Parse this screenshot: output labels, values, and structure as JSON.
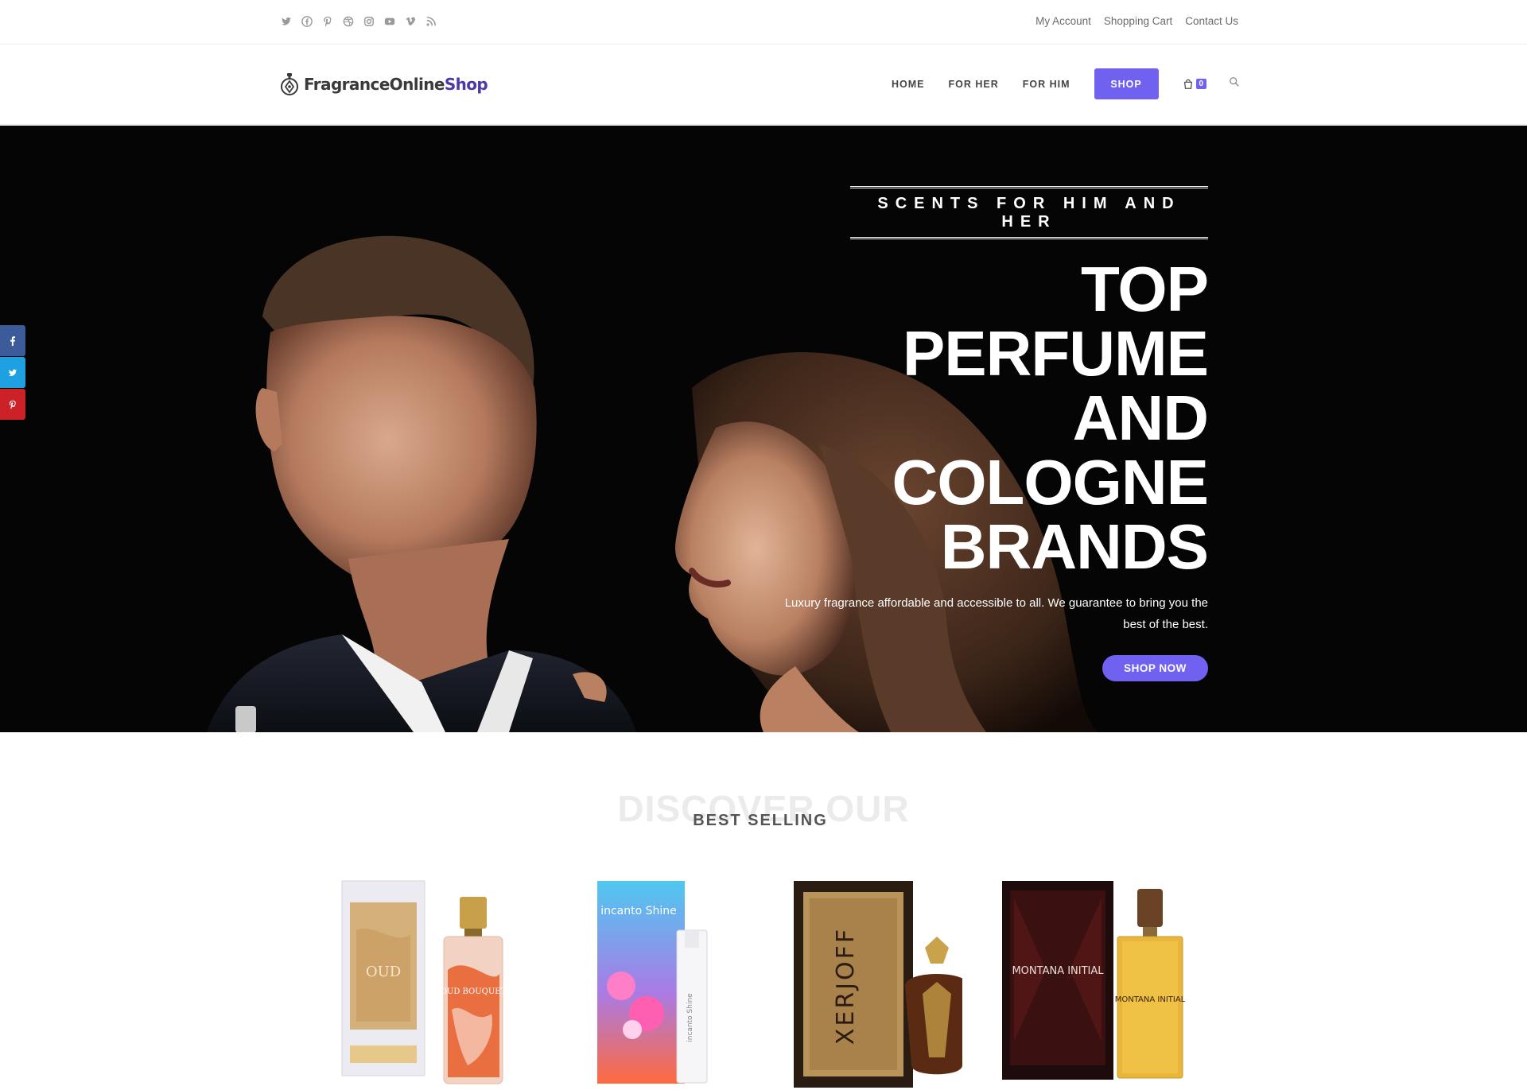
{
  "topbar": {
    "social_icons": [
      "twitter-icon",
      "facebook-icon",
      "pinterest-icon",
      "dribbble-icon",
      "instagram-icon",
      "youtube-icon",
      "vimeo-icon",
      "rss-icon"
    ],
    "links": [
      "My Account",
      "Shopping Cart",
      "Contact Us"
    ]
  },
  "header": {
    "logo_text": "FragranceOnline",
    "logo_accent": "Shop",
    "nav": [
      "HOME",
      "FOR HER",
      "FOR HIM"
    ],
    "shop_button": "SHOP",
    "cart_count": "0"
  },
  "hero": {
    "kicker": "SCENTS FOR HIM AND HER",
    "title_lines": [
      "TOP",
      "PERFUME",
      "AND",
      "COLOGNE",
      "BRANDS"
    ],
    "description": "Luxury fragrance affordable and accessible to all. We guarantee to bring you the best of the best.",
    "button": "SHOP NOW"
  },
  "share_bar": [
    "facebook-icon",
    "twitter-icon",
    "pinterest-icon"
  ],
  "section": {
    "background_text": "DISCOVER OUR",
    "title": "BEST SELLING"
  },
  "products": [
    {
      "box_text": "OUD",
      "bottle_text": "OUD BOUQUET"
    },
    {
      "box_text": "incanto Shine",
      "bottle_text": "incanto Shine"
    },
    {
      "box_text": "XERJOFF",
      "bottle_text": ""
    },
    {
      "box_text": "MONTANA INITIAL",
      "bottle_text": "MONTANA INITIAL"
    }
  ],
  "colors": {
    "accent": "#7161f0",
    "hero_bg": "#050505",
    "logo_accent": "#4a3aa8"
  }
}
